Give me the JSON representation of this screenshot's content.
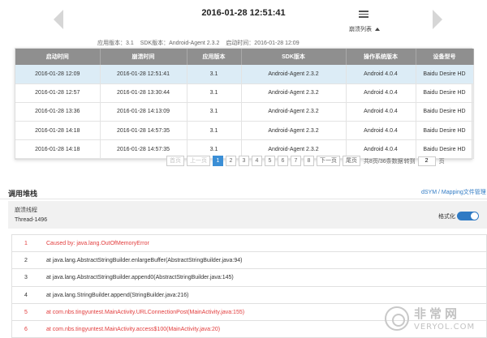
{
  "header": {
    "crash_time": "2016-01-28 12:51:41",
    "crash_list_label": "崩溃列表",
    "meta": {
      "app_version": "应用版本：3.1",
      "sdk_version": "SDK版本：Android-Agent 2.3.2",
      "start_time": "启动时间：2016-01-28 12:09"
    }
  },
  "crash_table": {
    "columns": [
      "启动时间",
      "崩溃时间",
      "应用版本",
      "SDK版本",
      "操作系统版本",
      "设备型号"
    ],
    "rows": [
      [
        "2016-01-28 12:09",
        "2016-01-28 12:51:41",
        "3.1",
        "Android-Agent 2.3.2",
        "Android 4.0.4",
        "Baidu Desire HD"
      ],
      [
        "2016-01-28 12:57",
        "2016-01-28 13:30:44",
        "3.1",
        "Android-Agent 2.3.2",
        "Android 4.0.4",
        "Baidu Desire HD"
      ],
      [
        "2016-01-28 13:36",
        "2016-01-28 14:13:09",
        "3.1",
        "Android-Agent 2.3.2",
        "Android 4.0.4",
        "Baidu Desire HD"
      ],
      [
        "2016-01-28 14:18",
        "2016-01-28 14:57:35",
        "3.1",
        "Android-Agent 2.3.2",
        "Android 4.0.4",
        "Baidu Desire HD"
      ],
      [
        "2016-01-28 14:18",
        "2016-01-28 14:57:35",
        "3.1",
        "Android-Agent 2.3.2",
        "Android 4.0.4",
        "Baidu Desire HD"
      ]
    ],
    "selected_row": 0
  },
  "pagination": {
    "first": "首页",
    "prev": "上一页",
    "pages": [
      "1",
      "2",
      "3",
      "4",
      "5",
      "6",
      "7",
      "8"
    ],
    "current": "1",
    "next": "下一页",
    "last": "尾页",
    "summary": "共8页/36条数据",
    "goto_label": "转到",
    "goto_value": "2",
    "page_unit": "页"
  },
  "stack": {
    "title": "调用堆栈",
    "dsym_link": "dSYM / Mapping文件管理",
    "thread_label": "崩溃线程",
    "thread_name": "Thread-1496",
    "format_label": "格式化",
    "format_on": true,
    "lines": [
      {
        "num": "1",
        "text": "Caused by: java.lang.OutOfMemoryError",
        "highlight": true
      },
      {
        "num": "2",
        "text": "at java.lang.AbstractStringBuilder.enlargeBuffer(AbstractStringBuilder.java:94)",
        "highlight": false
      },
      {
        "num": "3",
        "text": "at java.lang.AbstractStringBuilder.append0(AbstractStringBuilder.java:145)",
        "highlight": false
      },
      {
        "num": "4",
        "text": "at java.lang.StringBuilder.append(StringBuilder.java:216)",
        "highlight": false
      },
      {
        "num": "5",
        "text": "at com.nbs.tingyuntest.MainActivity.URLConnectionPost(MainActivity.java:155)",
        "highlight": true
      },
      {
        "num": "6",
        "text": "at com.nbs.tingyuntest.MainActivity.access$100(MainActivity.java:20)",
        "highlight": true
      }
    ]
  },
  "watermark": {
    "cn": "非常网",
    "en": "VERYOL.COM"
  },
  "colors": {
    "accent": "#3b8fd6",
    "link": "#2f7ac4",
    "error_text": "#e23c3c",
    "header_bg": "#8f8f8f",
    "selected_row": "#dcecf6"
  }
}
